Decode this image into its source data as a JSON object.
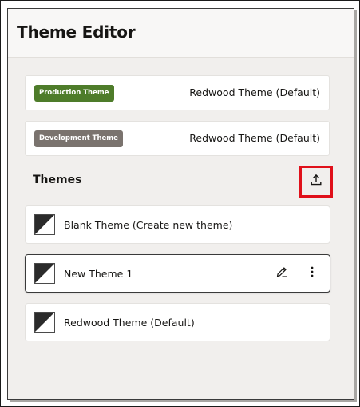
{
  "panel": {
    "title": "Theme Editor"
  },
  "assignments": [
    {
      "badge": "Production Theme",
      "badge_color": "#4e7c2a",
      "value": "Redwood Theme (Default)"
    },
    {
      "badge": "Development Theme",
      "badge_color": "#7a736e",
      "value": "Redwood Theme (Default)"
    }
  ],
  "themes_section": {
    "label": "Themes",
    "upload_icon": "upload-icon",
    "highlight_color": "#e0101a"
  },
  "themes": [
    {
      "name": "Blank Theme (Create new theme)",
      "icon": "theme-swatch-icon"
    },
    {
      "name": "New Theme 1",
      "icon": "theme-swatch-icon",
      "selected": true,
      "actions": [
        "pencil-icon",
        "more-vertical-icon"
      ]
    },
    {
      "name": "Redwood Theme (Default)",
      "icon": "theme-swatch-icon"
    }
  ]
}
